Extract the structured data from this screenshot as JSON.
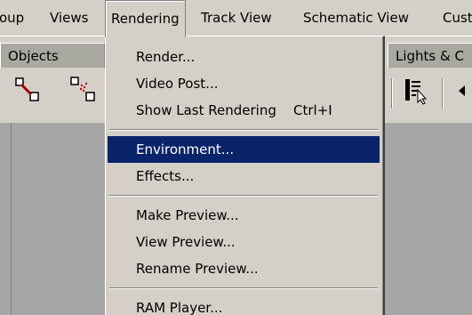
{
  "menubar": {
    "items": [
      {
        "label": "oup"
      },
      {
        "label": "Views"
      },
      {
        "label": "Rendering"
      },
      {
        "label": "Track View"
      },
      {
        "label": "Schematic View"
      },
      {
        "label": "Cust"
      }
    ]
  },
  "tabs": {
    "objects": "Objects",
    "lights": "Lights & C"
  },
  "toolbar": {
    "icons": [
      "link-icon",
      "unlink-icon",
      "select-list-icon"
    ]
  },
  "rendering_menu": {
    "groups": [
      [
        {
          "label": "Render...",
          "shortcut": ""
        },
        {
          "label": "Video Post...",
          "shortcut": ""
        },
        {
          "label": "Show Last Rendering",
          "shortcut": "Ctrl+I"
        }
      ],
      [
        {
          "label": "Environment...",
          "shortcut": "",
          "highlighted": true
        },
        {
          "label": "Effects...",
          "shortcut": ""
        }
      ],
      [
        {
          "label": "Make Preview...",
          "shortcut": ""
        },
        {
          "label": "View Preview...",
          "shortcut": ""
        },
        {
          "label": "Rename Preview...",
          "shortcut": ""
        }
      ],
      [
        {
          "label": "RAM Player...",
          "shortcut": ""
        }
      ]
    ]
  },
  "colors": {
    "face": "#d4d0c8",
    "highlight": "#0a246a",
    "viewport": "#a6a6a6"
  }
}
